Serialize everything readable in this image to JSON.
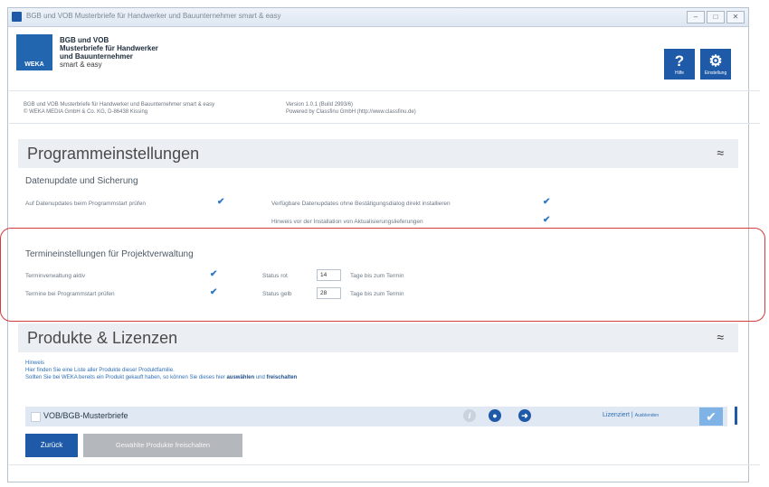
{
  "window": {
    "title": "BGB und VOB Musterbriefe für Handwerker und Bauunternehmer smart & easy",
    "controls": {
      "minimize": "–",
      "maximize": "□",
      "close": "✕"
    }
  },
  "header": {
    "logo_text": "WEKA",
    "product_line1": "BGB und VOB",
    "product_line2": "Musterbriefe für Handwerker",
    "product_line3": "und Bauunternehmer",
    "product_line4": "smart & easy",
    "help_glyph": "?",
    "help_label": "Hilfe",
    "settings_glyph": "⚙",
    "settings_label": "Einstellung"
  },
  "info": {
    "left_line1": "BGB und VOB Musterbriefe für Handwerker und Bauunternehmer smart & easy",
    "left_line2": "© WEKA MEDIA GmbH & Co. KG, D-86438 Kissing",
    "right_line1": "Version 1.0.1 (Build 2993/6)",
    "right_line2": "Powered by Classfinu GmbH (http://www.classfinu.de)"
  },
  "programmeinstellungen": {
    "title": "Programmeinstellungen",
    "chevron": "≈",
    "datenupdate": {
      "title": "Datenupdate und Sicherung",
      "opt1": "Auf Datenupdates beim Programmstart prüfen",
      "opt2": "Verfügbare Datenupdates ohne Bestätigungsdialog direkt installieren",
      "opt3": "Hinweis vor der Installation von Aktualisierungslieferungen"
    },
    "termine": {
      "title": "Termineinstellungen für Projektverwaltung",
      "opt1": "Terminverwaltung aktiv",
      "opt2": "Termine bei Programmstart prüfen",
      "status_rot_label": "Status rot",
      "status_rot_value": "14",
      "status_gelb_label": "Status gelb",
      "status_gelb_value": "28",
      "days_suffix": "Tage bis zum Termin"
    }
  },
  "check_glyph": "✔",
  "produkte": {
    "title": "Produkte & Lizenzen",
    "chevron": "≈",
    "hint_head": "Hinweis",
    "hint_line1": "Hier finden Sie eine Liste aller Produkte dieser Produktfamilie.",
    "hint_line2_a": "Sollten Sie bei WEKA bereits ein Produkt gekauft haben, so können Sie dieses hier ",
    "hint_line2_b": "auswählen",
    "hint_line2_c": " und ",
    "hint_line2_d": "freischalten",
    "product_name": "VOB/BGB-Musterbriefe",
    "info_glyph": "i",
    "user_glyph": "●",
    "arrow_glyph": "➜",
    "license_status": "Lizenziert",
    "license_action": "Ausblenden"
  },
  "buttons": {
    "back": "Zurück",
    "unlock": "Gewählte Produkte freischalten"
  }
}
